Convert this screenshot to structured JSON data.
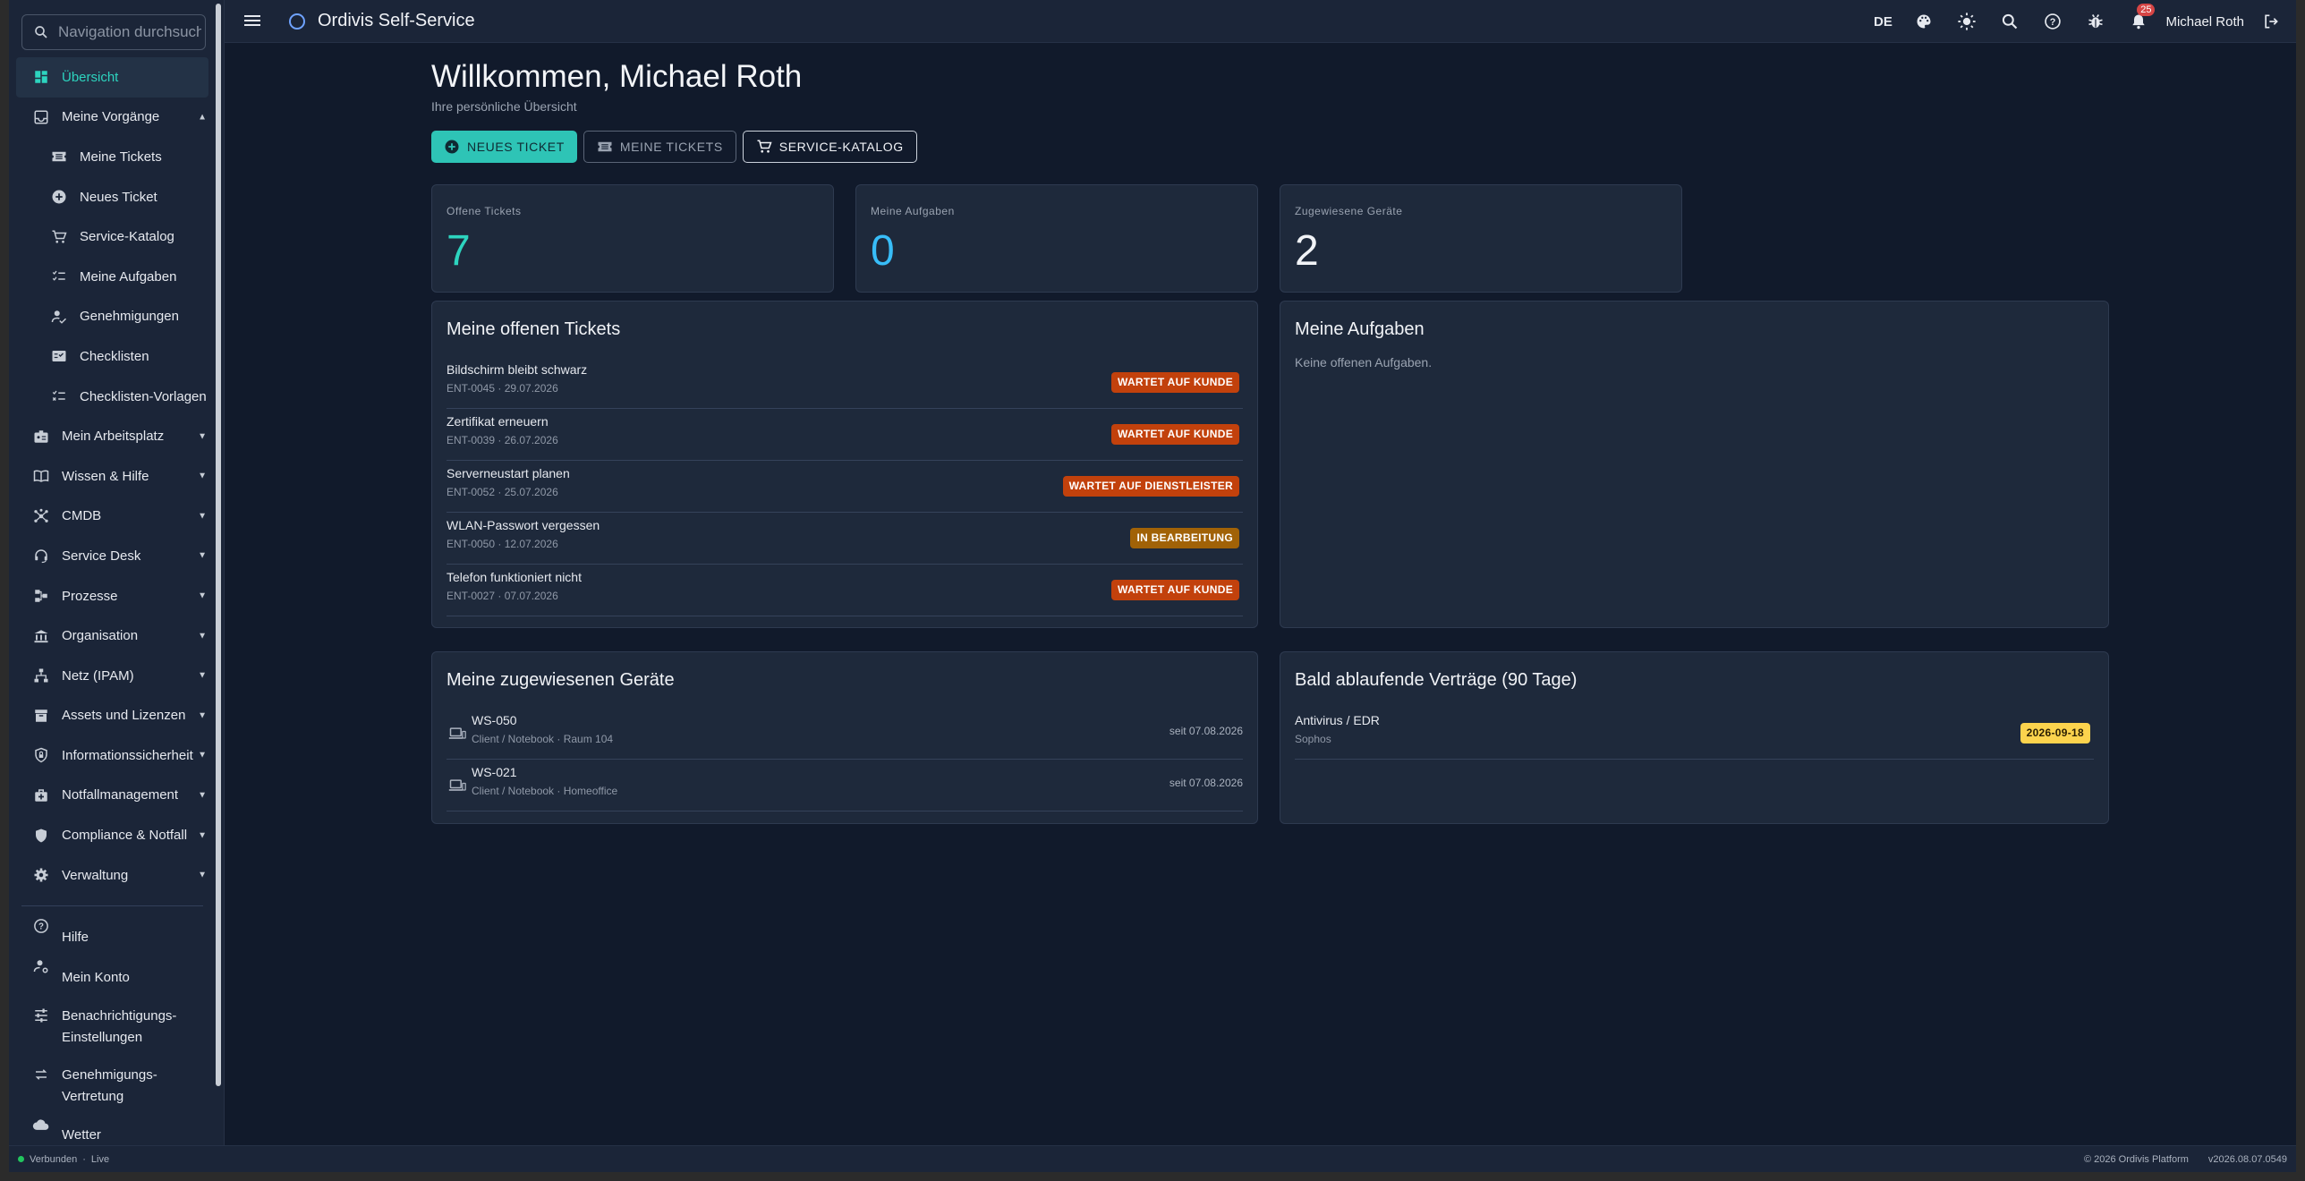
{
  "app": {
    "title": "Ordivis Self-Service"
  },
  "search": {
    "placeholder": "Navigation durchsuchen"
  },
  "sidebar": {
    "items": [
      {
        "label": "Übersicht",
        "icon": "dashboard-icon",
        "active": true
      },
      {
        "label": "Meine Vorgänge",
        "icon": "inbox-icon",
        "expanded": true
      },
      {
        "label": "Meine Tickets",
        "icon": "ticket-icon",
        "sub": true
      },
      {
        "label": "Neues Ticket",
        "icon": "plus-circle-icon",
        "sub": true
      },
      {
        "label": "Service-Katalog",
        "icon": "cart-icon",
        "sub": true
      },
      {
        "label": "Meine Aufgaben",
        "icon": "checklist-icon",
        "sub": true
      },
      {
        "label": "Genehmigungen",
        "icon": "approval-icon",
        "sub": true
      },
      {
        "label": "Checklisten",
        "icon": "fact-check-icon",
        "sub": true
      },
      {
        "label": "Checklisten-Vorlagen",
        "icon": "checklist-template-icon",
        "sub": true
      },
      {
        "label": "Mein Arbeitsplatz",
        "icon": "badge-icon"
      },
      {
        "label": "Wissen & Hilfe",
        "icon": "book-icon"
      },
      {
        "label": "CMDB",
        "icon": "hub-icon"
      },
      {
        "label": "Service Desk",
        "icon": "headset-icon"
      },
      {
        "label": "Prozesse",
        "icon": "process-icon"
      },
      {
        "label": "Organisation",
        "icon": "bank-icon"
      },
      {
        "label": "Netz (IPAM)",
        "icon": "network-icon"
      },
      {
        "label": "Assets und Lizenzen",
        "icon": "inventory-icon"
      },
      {
        "label": "Informationssicherheit",
        "icon": "shield-lock-icon"
      },
      {
        "label": "Notfallmanagement",
        "icon": "medical-bag-icon"
      },
      {
        "label": "Compliance & Notfall",
        "icon": "shield-icon"
      },
      {
        "label": "Verwaltung",
        "icon": "gear-icon"
      }
    ],
    "bottom": [
      {
        "label": "Hilfe",
        "icon": "help-icon"
      },
      {
        "label": "Mein Konto",
        "icon": "account-settings-icon"
      },
      {
        "label": "Benachrichtigungs-\nEinstellungen",
        "icon": "tune-icon"
      },
      {
        "label": "Genehmigungs-\nVertretung",
        "icon": "swap-icon"
      },
      {
        "label": "Wetter",
        "icon": "cloud-icon"
      }
    ]
  },
  "topbar": {
    "lang": "DE",
    "notifications": "25",
    "user": "Michael Roth"
  },
  "page": {
    "title": "Willkommen, Michael Roth",
    "subtitle": "Ihre persönliche Übersicht"
  },
  "actions": {
    "new_ticket": "NEUES TICKET",
    "my_tickets": "MEINE TICKETS",
    "catalog": "SERVICE-KATALOG"
  },
  "stats": [
    {
      "label": "Offene Tickets",
      "value": "7",
      "color": "#2dd4bf"
    },
    {
      "label": "Meine Aufgaben",
      "value": "0",
      "color": "#38bdf8"
    },
    {
      "label": "Zugewiesene Geräte",
      "value": "2",
      "color": "#f1f3f7"
    }
  ],
  "open_tickets": {
    "title": "Meine offenen Tickets",
    "rows": [
      {
        "title": "Bildschirm bleibt schwarz",
        "meta": "ENT-0045 · 29.07.2026",
        "status": "WARTET AUF KUNDE",
        "color": "#c2410c"
      },
      {
        "title": "Zertifikat erneuern",
        "meta": "ENT-0039 · 26.07.2026",
        "status": "WARTET AUF KUNDE",
        "color": "#c2410c"
      },
      {
        "title": "Serverneustart planen",
        "meta": "ENT-0052 · 25.07.2026",
        "status": "WARTET AUF DIENSTLEISTER",
        "color": "#c2410c"
      },
      {
        "title": "WLAN-Passwort vergessen",
        "meta": "ENT-0050 · 12.07.2026",
        "status": "IN BEARBEITUNG",
        "color": "#a16207"
      },
      {
        "title": "Telefon funktioniert nicht",
        "meta": "ENT-0027 · 07.07.2026",
        "status": "WARTET AUF KUNDE",
        "color": "#c2410c"
      }
    ]
  },
  "tasks": {
    "title": "Meine Aufgaben",
    "empty": "Keine offenen Aufgaben."
  },
  "devices": {
    "title": "Meine zugewiesenen Geräte",
    "rows": [
      {
        "name": "WS-050",
        "meta": "Client / Notebook · Raum 104",
        "since": "seit 07.08.2026"
      },
      {
        "name": "WS-021",
        "meta": "Client / Notebook · Homeoffice",
        "since": "seit 07.08.2026"
      }
    ]
  },
  "contracts": {
    "title": "Bald ablaufende Verträge (90 Tage)",
    "rows": [
      {
        "name": "Antivirus / EDR",
        "vendor": "Sophos",
        "date": "2026-09-18"
      }
    ]
  },
  "footer": {
    "status": "Verbunden",
    "mode": "Live",
    "copyright": "© 2026 Ordivis Platform",
    "version": "v2026.08.07.0549"
  }
}
